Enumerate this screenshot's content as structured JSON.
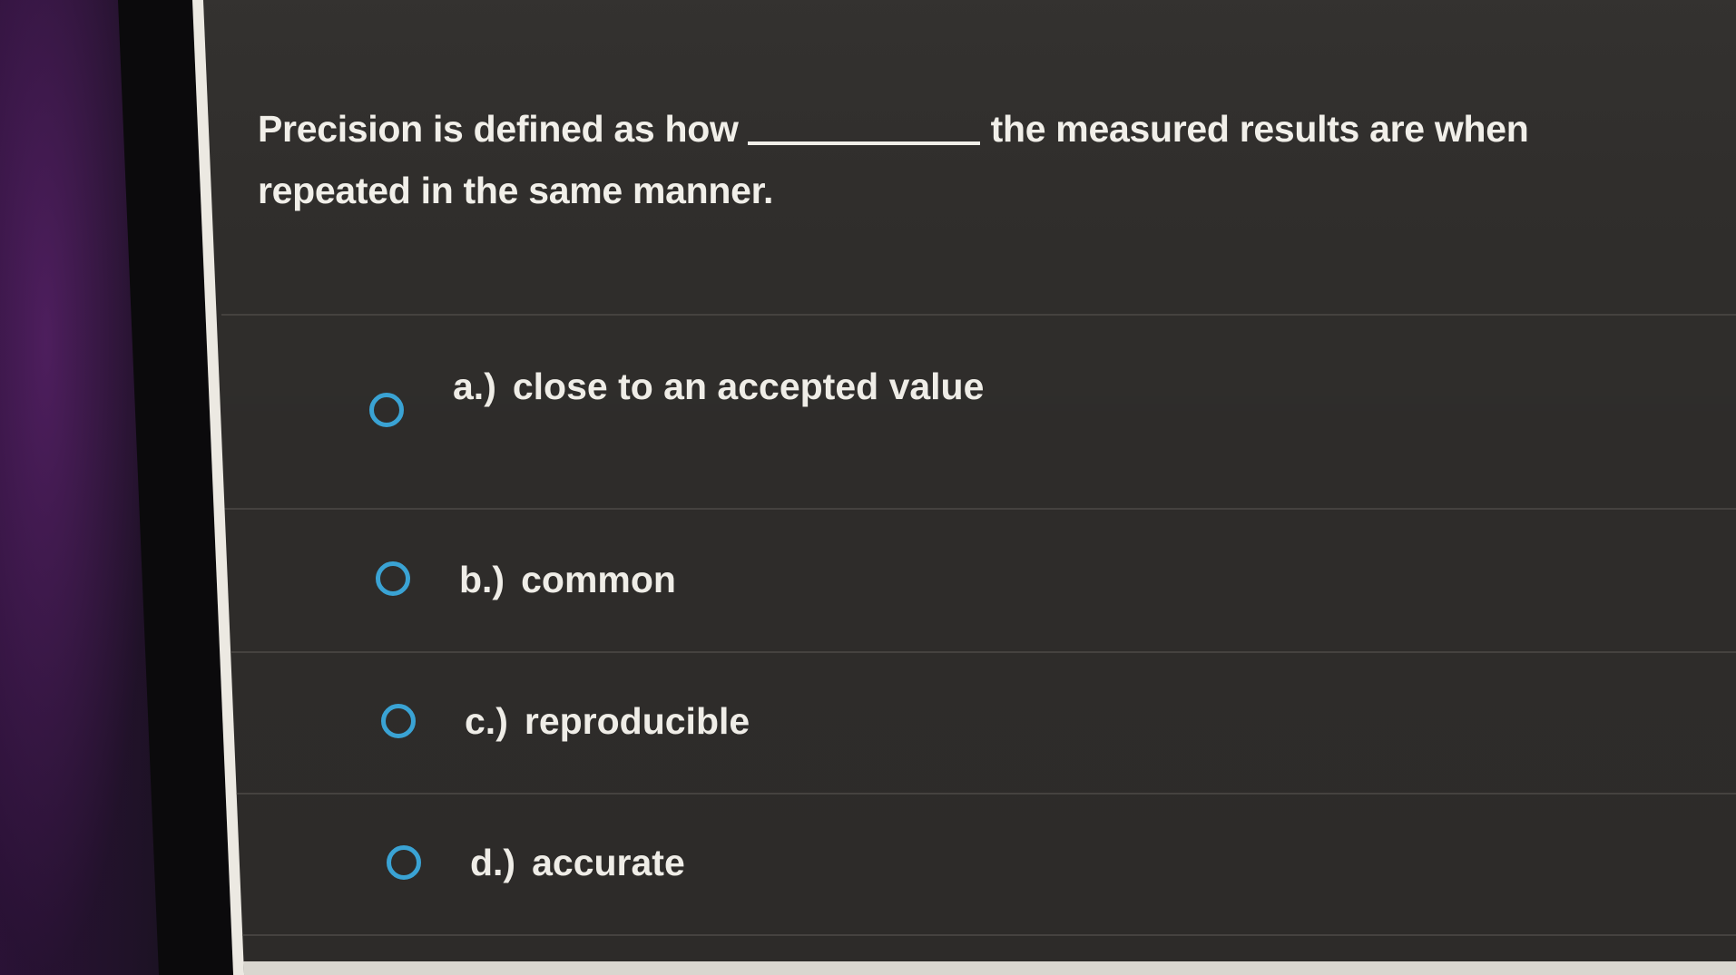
{
  "question": {
    "part1": "Precision is defined as how",
    "part2": "the measured results are when repeated in the same manner."
  },
  "options": [
    {
      "letter": "a.)",
      "text": "close to an accepted value"
    },
    {
      "letter": "b.)",
      "text": "common"
    },
    {
      "letter": "c.)",
      "text": "reproducible"
    },
    {
      "letter": "d.)",
      "text": "accurate"
    }
  ],
  "colors": {
    "radio_accent": "#3aa3d4",
    "panel_background": "#2f2d2b",
    "text": "#f1efe9"
  },
  "icons": {
    "radio": "radio-unselected-icon"
  }
}
